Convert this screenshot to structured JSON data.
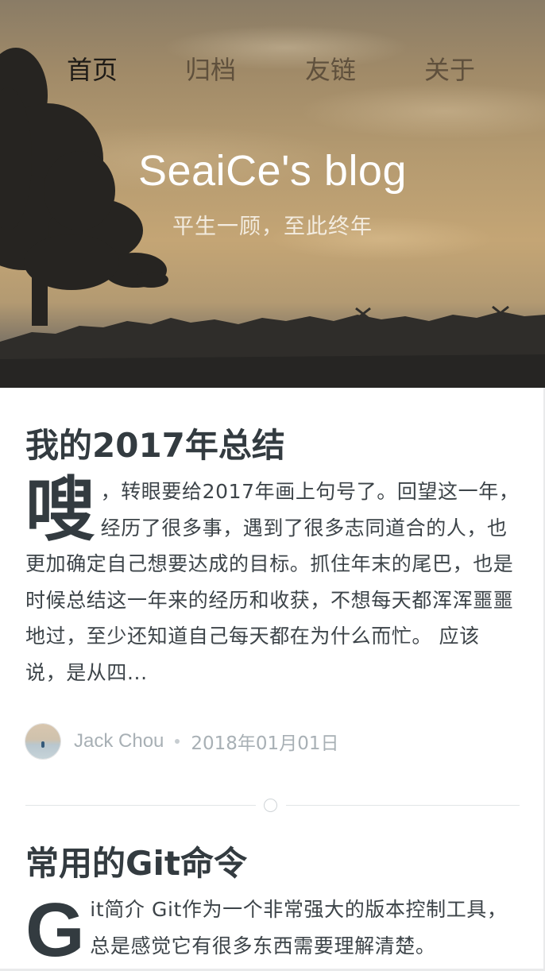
{
  "nav": {
    "items": [
      {
        "label": "首页",
        "active": true
      },
      {
        "label": "归档",
        "active": false
      },
      {
        "label": "友链",
        "active": false
      },
      {
        "label": "关于",
        "active": false
      }
    ]
  },
  "header": {
    "title": "SeaiCe's blog",
    "subtitle": "平生一顾，至此终年"
  },
  "posts": [
    {
      "title": "我的2017年总结",
      "dropcap": "嗖",
      "excerpt": "嗖，转眼要给2017年画上句号了。回望这一年，经历了很多事，遇到了很多志同道合的人，也更加确定自己想要达成的目标。抓住年末的尾巴，也是时候总结这一年来的经历和收获，不想每天都浑浑噩噩地过，至少还知道自己每天都在为什么而忙。 应该说，是从四...",
      "author": "Jack Chou",
      "date": "2018年01月01日"
    },
    {
      "title": "常用的Git命令",
      "dropcap": "G",
      "excerpt": "it简介 Git作为一个非常强大的版本控制工具，总是感觉它有很多东西需要理解清楚。"
    }
  ],
  "colors": {
    "text": "#333b40",
    "meta": "#a8b0b5",
    "divider": "#e2e5e7"
  }
}
